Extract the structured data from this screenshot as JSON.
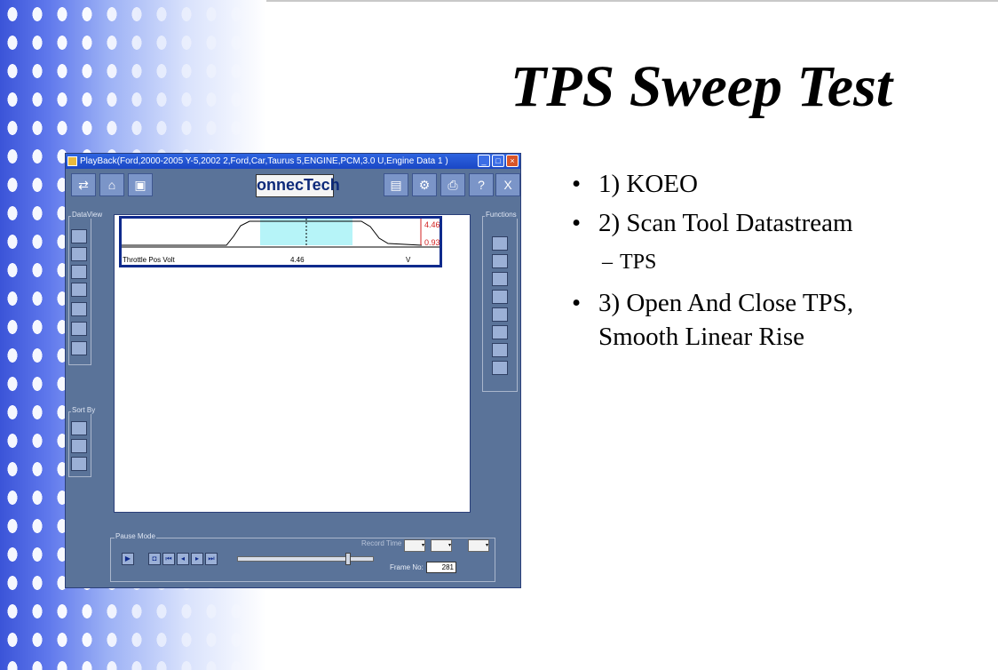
{
  "slide": {
    "title": "TPS Sweep Test",
    "bullets": [
      "1) KOEO",
      "2) Scan Tool Datastream",
      "3) Open And Close TPS, Smooth Linear Rise"
    ],
    "sub_bullet": "TPS"
  },
  "window": {
    "title": "PlayBack(Ford,2000-2005 Y-5,2002 2,Ford,Car,Taurus 5,ENGINE,PCM,3.0 U,Engine Data 1 )",
    "logo": "onnecTech",
    "toolbar_help_glyph": "?",
    "toolbar_close_glyph": "X"
  },
  "dataview": {
    "label": "DataView"
  },
  "sortby": {
    "label": "Sort By"
  },
  "functions": {
    "label": "Functions"
  },
  "graph": {
    "label": "Throttle Pos Volt",
    "value": "4.46",
    "unit": "V",
    "max": "4.46",
    "min": "0.93"
  },
  "pause": {
    "label": "Pause Mode",
    "record_time_label": "Record Time",
    "frame_label": "Frame No:",
    "frame_value": "281",
    "slider_position": 0.83
  },
  "colors": {
    "graph_border": "#0f2a8c",
    "highlight": "#b6f4f8",
    "minmax": "#d12020"
  }
}
